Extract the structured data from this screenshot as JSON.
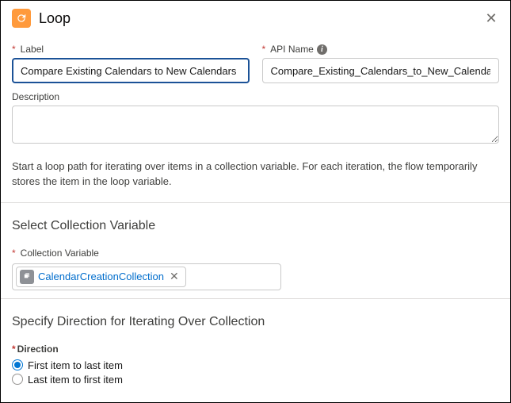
{
  "header": {
    "title": "Loop"
  },
  "fields": {
    "label_label": "Label",
    "label_value": "Compare Existing Calendars to New Calendars",
    "api_name_label": "API Name",
    "api_name_value": "Compare_Existing_Calendars_to_New_Calendars",
    "description_label": "Description",
    "description_value": ""
  },
  "help_text": "Start a loop path for iterating over items in a collection variable. For each iteration, the flow temporarily stores the item in the loop variable.",
  "collection": {
    "section_title": "Select Collection Variable",
    "field_label": "Collection Variable",
    "pill_label": "CalendarCreationCollection"
  },
  "direction": {
    "section_title": "Specify Direction for Iterating Over Collection",
    "field_label": "Direction",
    "option1": "First item to last item",
    "option2": "Last item to first item"
  }
}
